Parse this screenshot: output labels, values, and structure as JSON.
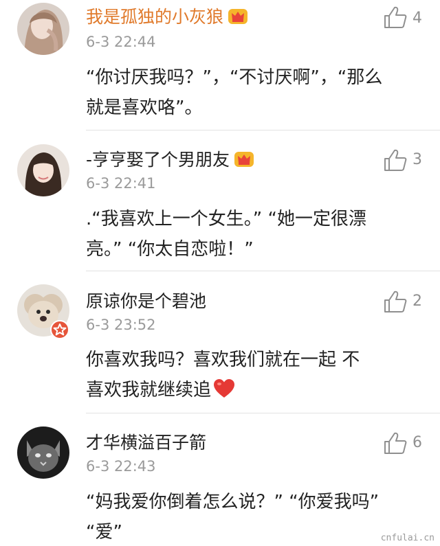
{
  "comments": [
    {
      "username": "我是孤独的小灰狼",
      "vip_crown": "crown-icon",
      "time": "6-3 22:44",
      "likes": "4",
      "text_lines": [
        "“你讨厌我吗？”，“不讨厌啊”，“那么",
        "就是喜欢咯”。"
      ]
    },
    {
      "username": "-亨亨娶了个男朋友",
      "vip_crown": "crown-icon",
      "time": "6-3 22:41",
      "likes": "3",
      "text_lines": [
        ".“我喜欢上一个女生。” “她一定很漂",
        "亮。” “你太自恋啦！”"
      ]
    },
    {
      "username": "原谅你是个碧池",
      "verified_badge": "verified-badge-icon",
      "time": "6-3 23:52",
      "likes": "2",
      "text_lines": [
        "你喜欢我吗？喜欢我们就在一起  不",
        "喜欢我就继续追"
      ],
      "emoji": "heart-icon"
    },
    {
      "username": "才华横溢百子箭",
      "time": "6-3 22:43",
      "likes": "6",
      "text_lines": [
        "“妈我爱你倒着怎么说？” “你爱我吗”",
        "“爱”"
      ]
    }
  ],
  "colors": {
    "vip_name": "#e07a2b",
    "name": "#222222",
    "time": "#9a9a9a",
    "divider": "#e2e2e2",
    "badge": "#e6553a",
    "heart": "#e53935"
  },
  "watermark": "cnfulai.cn"
}
